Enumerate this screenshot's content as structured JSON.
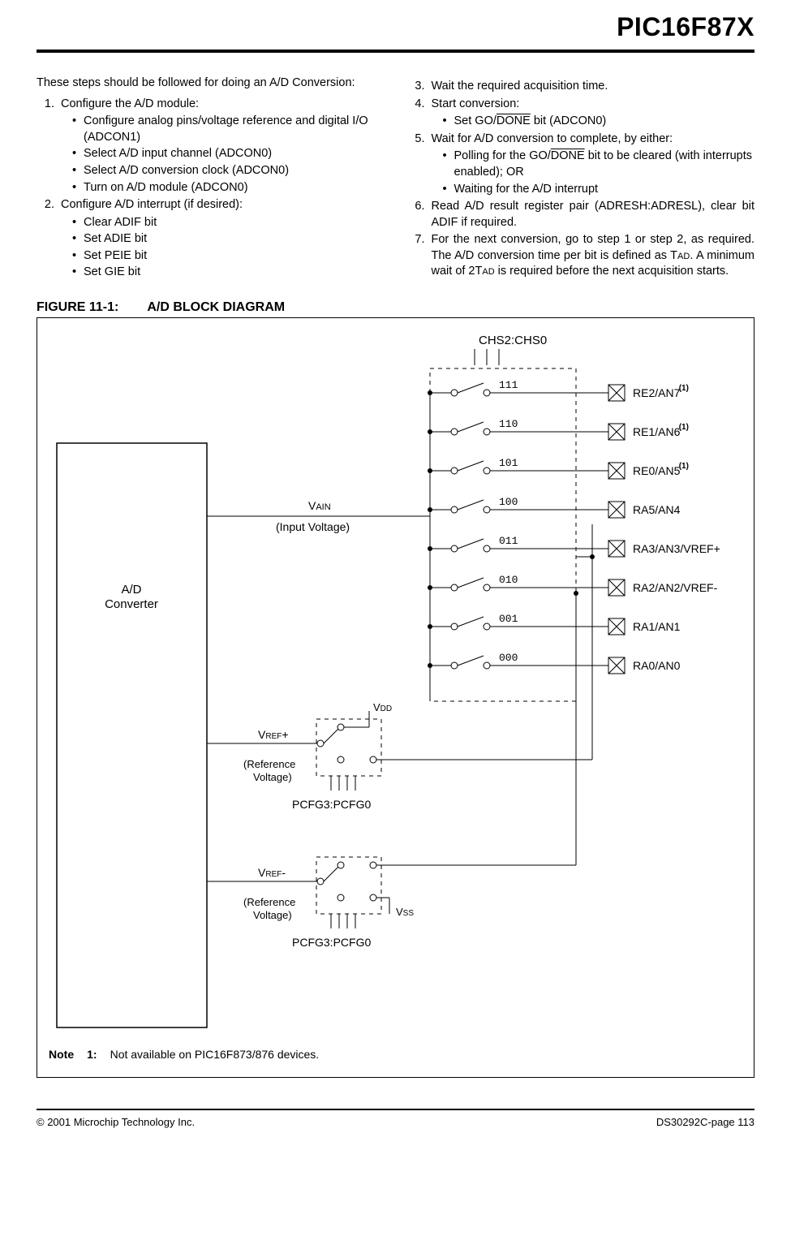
{
  "header": {
    "product": "PIC16F87X"
  },
  "intro_left": "These steps should be followed for doing an A/D Conversion:",
  "steps_left": [
    {
      "text": "Configure the A/D module:",
      "sub": [
        "Configure analog pins/voltage reference and digital I/O (ADCON1)",
        "Select A/D input channel (ADCON0)",
        "Select A/D conversion clock (ADCON0)",
        "Turn on A/D module (ADCON0)"
      ]
    },
    {
      "text": "Configure A/D interrupt (if desired):",
      "sub": [
        "Clear ADIF bit",
        "Set ADIE bit",
        "Set PEIE bit",
        "Set GIE bit"
      ]
    }
  ],
  "steps_right": [
    {
      "num": "3.",
      "text": "Wait the required acquisition time."
    },
    {
      "num": "4.",
      "text": "Start conversion:",
      "sub_html": [
        "Set GO/<span class=\"overline\">DONE</span> bit (ADCON0)"
      ]
    },
    {
      "num": "5.",
      "text": "Wait for A/D conversion to complete, by either:",
      "sub_html": [
        "Polling for the GO/<span class=\"overline\">DONE</span> bit to be cleared (with interrupts enabled); OR",
        "Waiting for the A/D interrupt"
      ]
    },
    {
      "num": "6.",
      "text_html": "Read A/D result register pair (ADRESH:ADRESL), clear bit ADIF if required."
    },
    {
      "num": "7.",
      "text_html": "For the next conversion, go to step 1 or step 2, as required. The A/D conversion time per bit is defined as T<span class=\"smallcaps-sub\">AD</span>. A minimum wait of 2T<span class=\"smallcaps-sub\">AD</span> is required before the next acquisition starts."
    }
  ],
  "figure": {
    "label": "FIGURE 11-1:",
    "title": "A/D BLOCK DIAGRAM",
    "chs_label": "CHS2:CHS0",
    "converter_label1": "A/D",
    "converter_label2": "Converter",
    "vain": "VAIN",
    "input_voltage": "(Input Voltage)",
    "vdd": "VDD",
    "vss": "VSS",
    "vrefp": "VREF+",
    "vrefm": "VREF-",
    "ref_voltage": "(Reference Voltage)",
    "pcfg": "PCFG3:PCFG0",
    "channels": [
      {
        "code": "111",
        "pin": "RE2/AN7",
        "note1": true
      },
      {
        "code": "110",
        "pin": "RE1/AN6",
        "note1": true
      },
      {
        "code": "101",
        "pin": "RE0/AN5",
        "note1": true
      },
      {
        "code": "100",
        "pin": "RA5/AN4",
        "note1": false
      },
      {
        "code": "011",
        "pin": "RA3/AN3/VREF+",
        "note1": false
      },
      {
        "code": "010",
        "pin": "RA2/AN2/VREF-",
        "note1": false
      },
      {
        "code": "001",
        "pin": "RA1/AN1",
        "note1": false
      },
      {
        "code": "000",
        "pin": "RA0/AN0",
        "note1": false
      }
    ],
    "note_label": "Note",
    "note_num": "1:",
    "note_text": "Not available on PIC16F873/876 devices."
  },
  "footer": {
    "left": "© 2001 Microchip Technology Inc.",
    "right": "DS30292C-page 113"
  }
}
